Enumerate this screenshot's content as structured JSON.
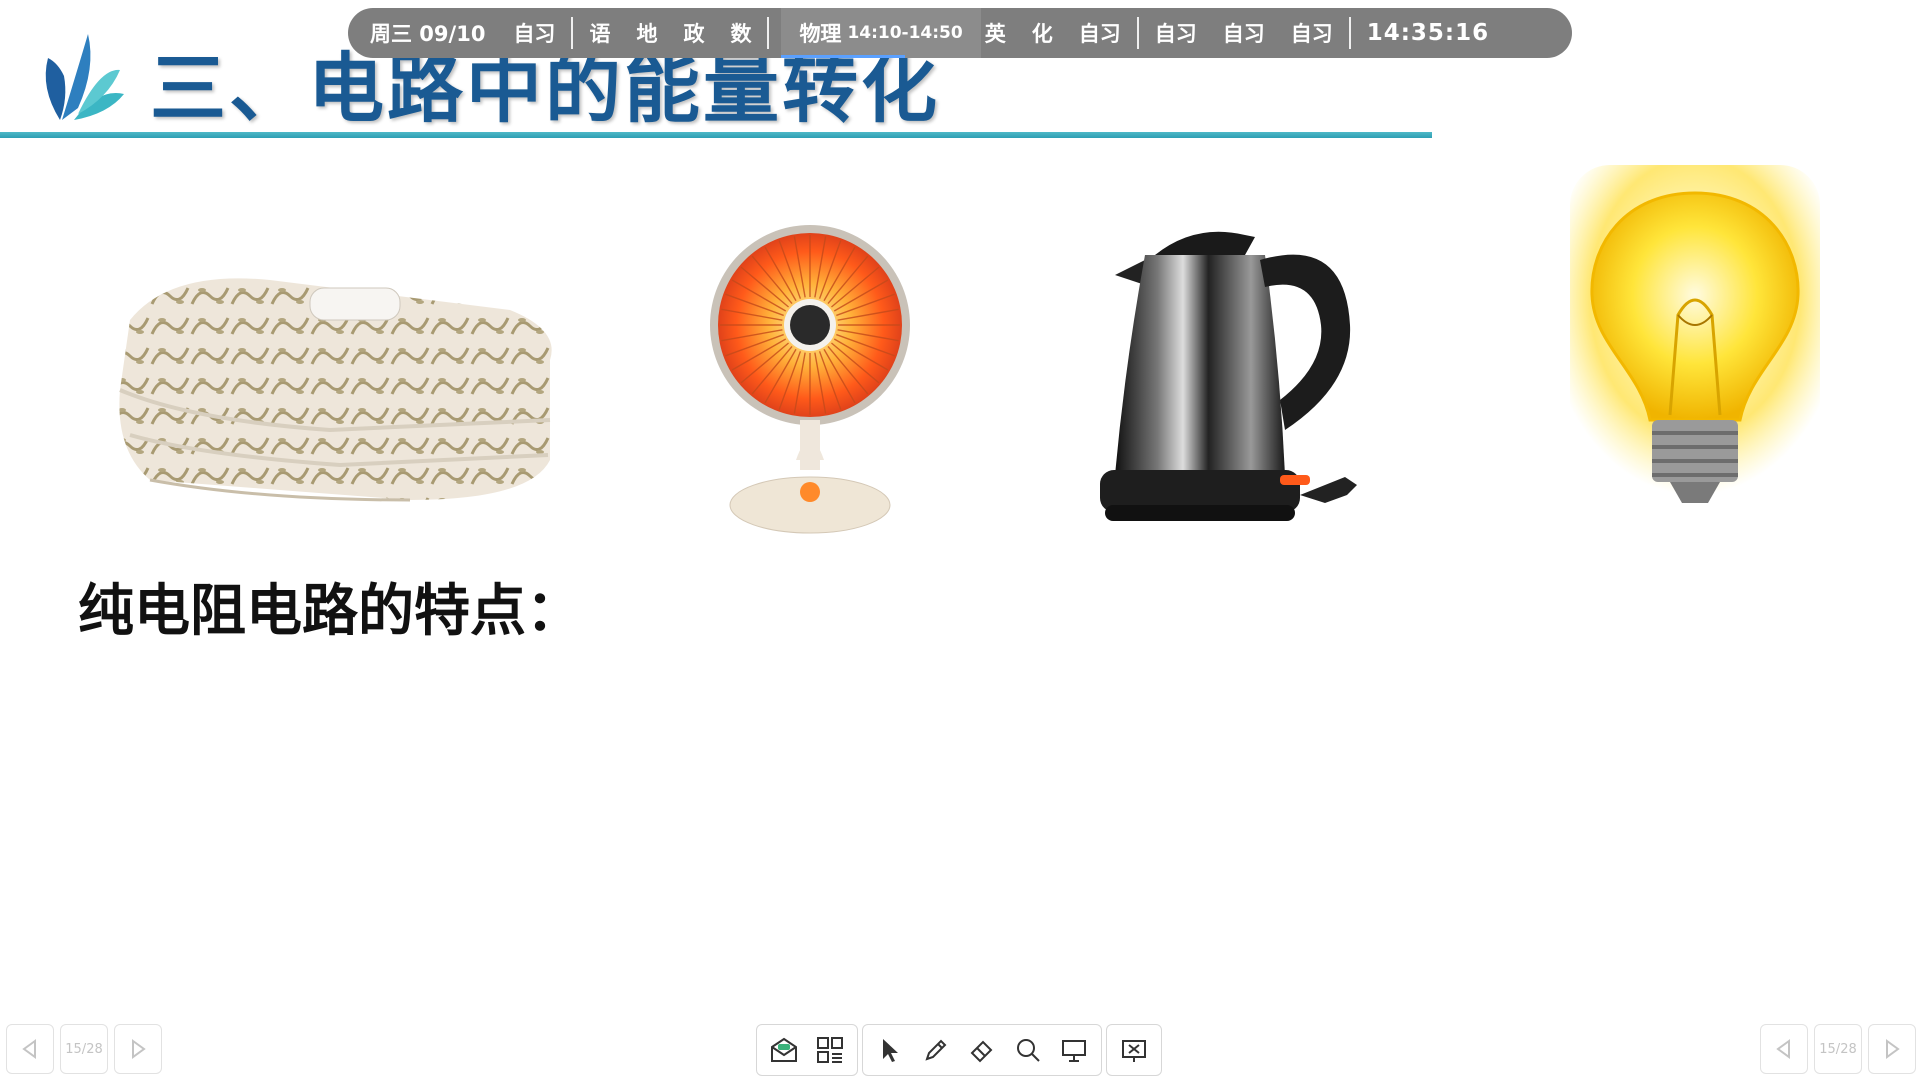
{
  "schedule": {
    "date_label": "周三 09/10",
    "first_period": "自习",
    "morning_subjects": [
      "语",
      "地",
      "政",
      "数"
    ],
    "current": {
      "subject": "物理",
      "time": "14:10-14:50",
      "progress": 0.62
    },
    "afternoon_subjects": [
      "英",
      "化",
      "自习"
    ],
    "evening_subjects": [
      "自习",
      "自习",
      "自习"
    ],
    "clock": "14:35:16"
  },
  "slide": {
    "title": "三、电路中的能量转化",
    "subtitle": "纯电阻电路的特点：",
    "images": [
      "electric-blanket",
      "electric-heater",
      "electric-kettle",
      "light-bulb"
    ],
    "accent_color": "#1a5a93",
    "rule_color": "#2e9fb3"
  },
  "navigation": {
    "left_page": "15/28",
    "right_page": "15/28"
  },
  "toolbar": {
    "tools": [
      "envelope-icon",
      "qr-grid-icon",
      "pointer-icon",
      "pen-icon",
      "eraser-icon",
      "magnifier-icon",
      "screen-icon",
      "close-presentation-icon"
    ]
  }
}
